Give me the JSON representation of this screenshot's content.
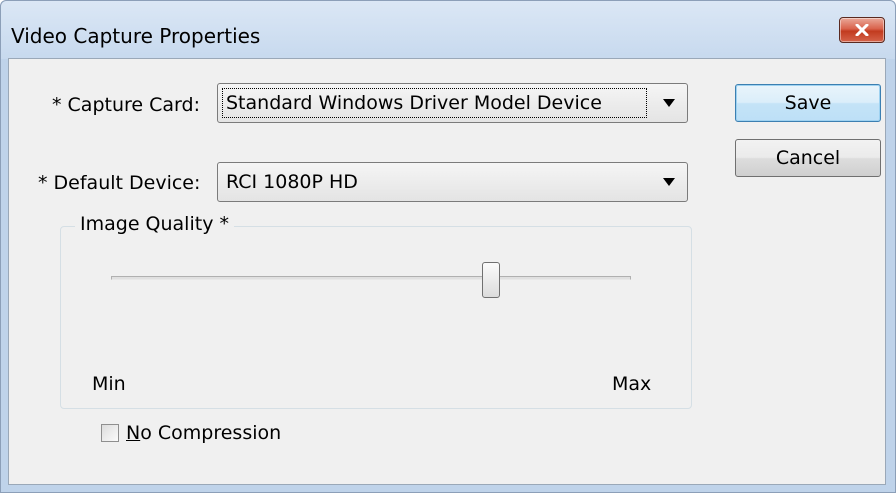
{
  "window": {
    "title": "Video Capture Properties"
  },
  "form": {
    "capture_card": {
      "label": "* Capture Card:",
      "value": "Standard Windows Driver Model Device"
    },
    "default_device": {
      "label": "* Default Device:",
      "value": "RCI 1080P HD"
    }
  },
  "buttons": {
    "save": "Save",
    "cancel": "Cancel"
  },
  "image_quality": {
    "title": "Image Quality *",
    "min_label": "Min",
    "max_label": "Max",
    "slider_level": 0.73
  },
  "no_compression": {
    "label_first": "N",
    "label_rest": "o Compression",
    "checked": false
  },
  "icons": {
    "close": "close-icon",
    "dropdown": "chevron-down-icon"
  },
  "colors": {
    "close_button": "#c23b1f",
    "default_button_border": "#3c7fb1",
    "titlebar": "#c7d9ee"
  }
}
